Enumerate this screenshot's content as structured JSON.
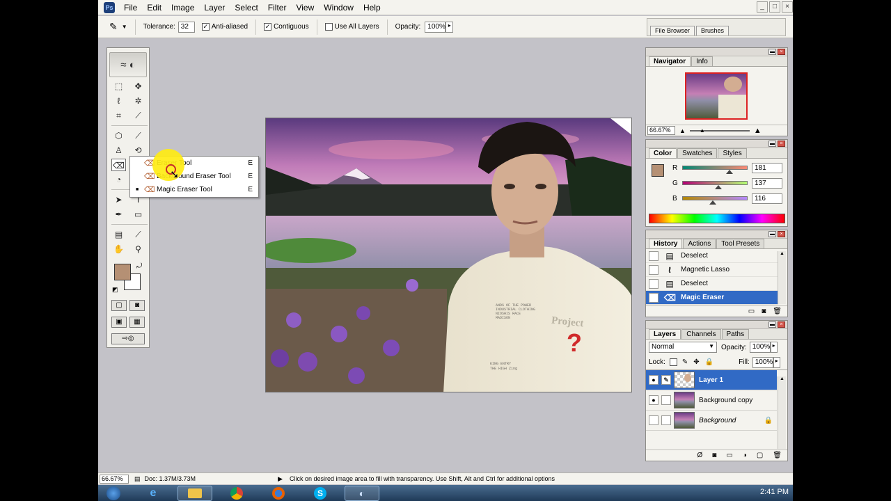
{
  "menu": [
    "File",
    "Edit",
    "Image",
    "Layer",
    "Select",
    "Filter",
    "View",
    "Window",
    "Help"
  ],
  "window_controls": [
    "_",
    "□",
    "×"
  ],
  "options_bar": {
    "tolerance_label": "Tolerance:",
    "tolerance_value": "32",
    "anti_aliased": "Anti-aliased",
    "contiguous": "Contiguous",
    "use_all_layers": "Use All Layers",
    "opacity_label": "Opacity:",
    "opacity_value": "100%",
    "palette_well_tabs": [
      "File Browser",
      "Brushes"
    ]
  },
  "flyout": {
    "items": [
      {
        "label": "Eraser Tool",
        "key": "E"
      },
      {
        "label": "Background Eraser Tool",
        "key": "E"
      },
      {
        "label": "Magic Eraser Tool",
        "key": "E"
      }
    ]
  },
  "navigator": {
    "tabs": [
      "Navigator",
      "Info"
    ],
    "zoom": "66.67%"
  },
  "color": {
    "tabs": [
      "Color",
      "Swatches",
      "Styles"
    ],
    "foreground_color": "#b59074",
    "channels": [
      {
        "label": "R",
        "value": "181"
      },
      {
        "label": "G",
        "value": "137"
      },
      {
        "label": "B",
        "value": "116"
      }
    ]
  },
  "history": {
    "tabs": [
      "History",
      "Actions",
      "Tool Presets"
    ],
    "items": [
      "Deselect",
      "Magnetic Lasso",
      "Deselect",
      "Magic Eraser"
    ]
  },
  "layers": {
    "tabs": [
      "Layers",
      "Channels",
      "Paths"
    ],
    "blend_mode": "Normal",
    "opacity_label": "Opacity:",
    "opacity_value": "100%",
    "lock_label": "Lock:",
    "fill_label": "Fill:",
    "fill_value": "100%",
    "items": [
      {
        "name": "Layer 1"
      },
      {
        "name": "Background copy"
      },
      {
        "name": "Background"
      }
    ]
  },
  "status": {
    "zoom": "66.67%",
    "doc": "Doc: 1.37M/3.73M",
    "hint": "Click on desired image area to fill with transparency.  Use Shift, Alt and Ctrl for additional options"
  },
  "taskbar": {
    "clock": "2:41 PM"
  },
  "canvas_overlay": {
    "shirt_text_line1": "ANDS OF THE POWER",
    "shirt_text_line2": "INDUSTRIAL CLOTHING",
    "shirt_text_line3": "NIOSHIS RACE",
    "shirt_text_line4": "MADISON",
    "shirt_text_line5": "KING ENTRY",
    "shirt_text_line6": "THE HIGH Zing",
    "shirt_mark": "?",
    "shirt_word": "Project"
  }
}
